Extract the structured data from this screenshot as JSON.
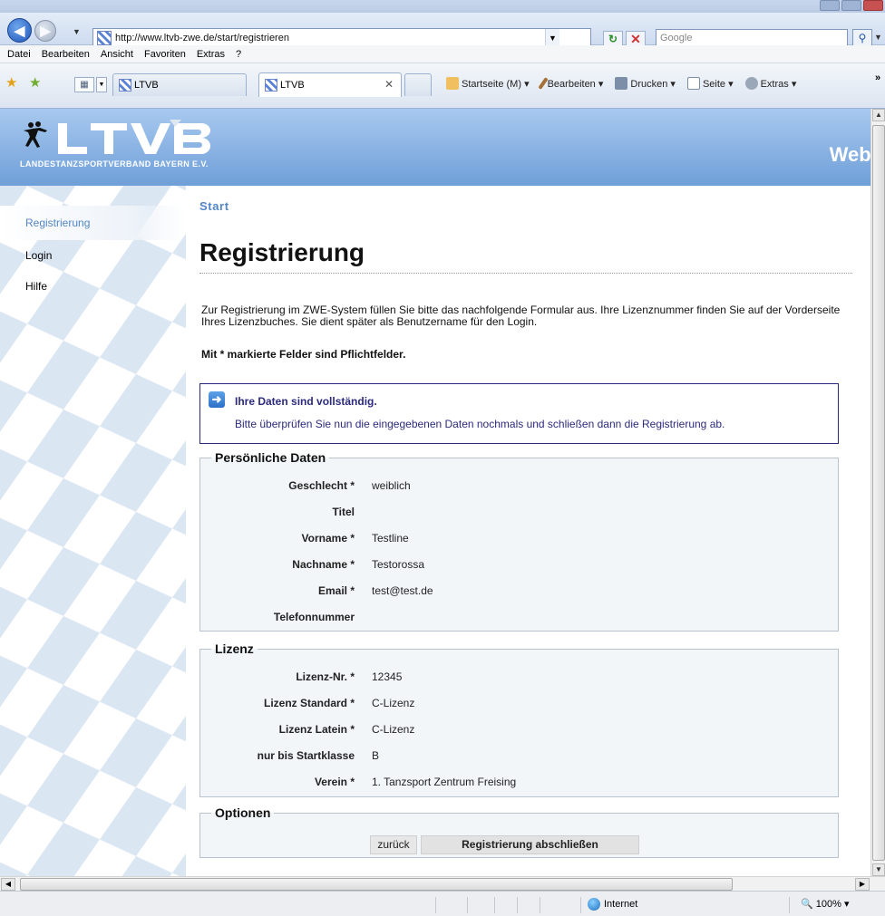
{
  "browser": {
    "url": "http://www.ltvb-zwe.de/start/registrieren",
    "search_placeholder": "Google",
    "menu": [
      "Datei",
      "Bearbeiten",
      "Ansicht",
      "Favoriten",
      "Extras",
      "?"
    ],
    "tabs": [
      "LTVB",
      "LTVB"
    ],
    "commands": [
      "Startseite (M)",
      "Bearbeiten",
      "Drucken",
      "Seite",
      "Extras"
    ],
    "status_zone": "Internet",
    "zoom": "100%"
  },
  "header": {
    "logo_text": "LANDESTANZSPORTVERBAND BAYERN E.V.",
    "web_title": "Web-"
  },
  "sidebar": {
    "items": [
      "Registrierung",
      "Login",
      "Hilfe"
    ]
  },
  "content": {
    "breadcrumb": "Start",
    "title": "Registrierung",
    "intro": "Zur Registrierung im ZWE-System füllen Sie bitte das nachfolgende Formular aus. Ihre Lizenznummer finden Sie auf der Vorderseite Ihres Lizenzbuches. Sie dient später als Benutzername für den Login.",
    "required_note": "Mit * markierte Felder sind Pflichtfelder.",
    "notice": {
      "title": "Ihre Daten sind vollständig.",
      "text": "Bitte überprüfen Sie nun die eingegebenen Daten nochmals und schließen dann die Registrierung ab."
    },
    "personal": {
      "legend": "Persönliche Daten",
      "rows": [
        {
          "label": "Geschlecht *",
          "value": "weiblich"
        },
        {
          "label": "Titel",
          "value": ""
        },
        {
          "label": "Vorname *",
          "value": "Testline"
        },
        {
          "label": "Nachname *",
          "value": "Testorossa"
        },
        {
          "label": "Email *",
          "value": "test@test.de"
        },
        {
          "label": "Telefonnummer",
          "value": ""
        }
      ]
    },
    "lizenz": {
      "legend": "Lizenz",
      "rows": [
        {
          "label": "Lizenz-Nr. *",
          "value": "12345"
        },
        {
          "label": "Lizenz Standard *",
          "value": "C-Lizenz"
        },
        {
          "label": "Lizenz Latein *",
          "value": "C-Lizenz"
        },
        {
          "label": "nur bis Startklasse",
          "value": "B"
        },
        {
          "label": "Verein *",
          "value": "1. Tanzsport Zentrum Freising"
        }
      ]
    },
    "optionen": {
      "legend": "Optionen",
      "back_label": "zurück",
      "finish_label": "Registrierung abschließen"
    }
  }
}
